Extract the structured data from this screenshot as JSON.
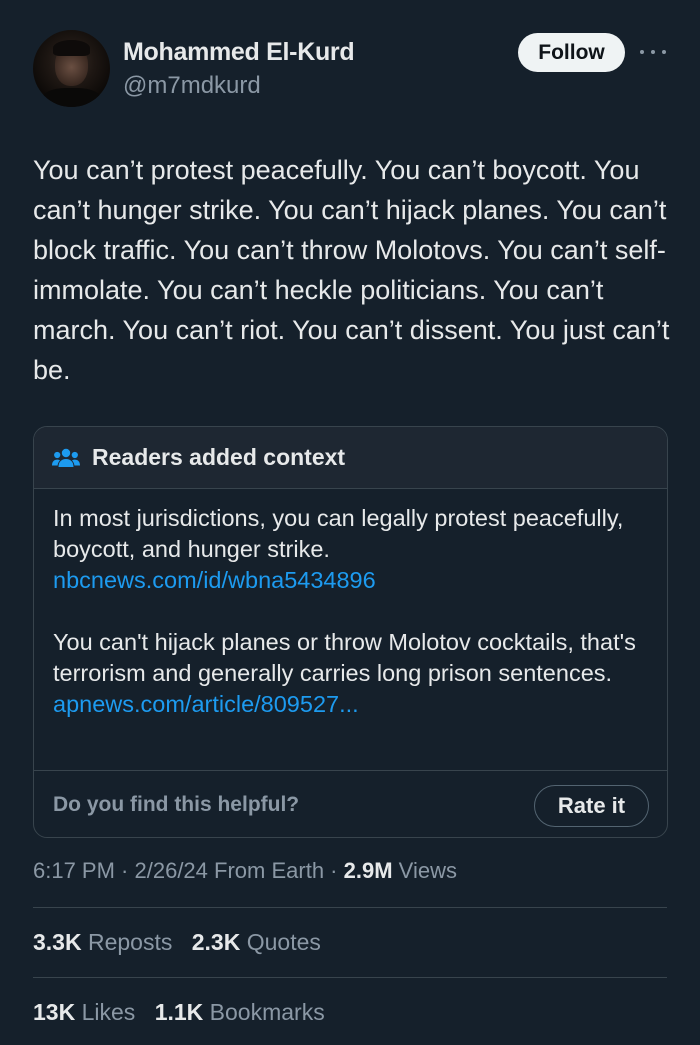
{
  "author": {
    "name": "Mohammed El-Kurd",
    "handle": "@m7mdkurd",
    "follow_label": "Follow"
  },
  "tweet": {
    "text": "You can’t protest peacefully. You can’t boycott. You can’t hunger strike. You can’t hijack planes. You can’t block traffic. You can’t throw Molotovs. You can’t self-immolate. You can’t heckle politicians. You can’t march. You can’t riot. You can’t dissent. You just can’t be."
  },
  "community_note": {
    "title": "Readers added context",
    "paragraph_1": "In most jurisdictions, you can legally protest peacefully, boycott, and hunger strike.",
    "link_1": "nbcnews.com/id/wbna5434896",
    "paragraph_2": "You can't hijack planes or throw Molotov cocktails, that's terrorism and generally carries long prison sentences.",
    "link_2": "apnews.com/article/809527...",
    "helpful_question": "Do you find this helpful?",
    "rate_label": "Rate it"
  },
  "meta": {
    "time": "6:17 PM",
    "date": "2/26/24",
    "source": "From Earth",
    "views_count": "2.9M",
    "views_label": "Views"
  },
  "stats": {
    "reposts_count": "3.3K",
    "reposts_label": "Reposts",
    "quotes_count": "2.3K",
    "quotes_label": "Quotes",
    "likes_count": "13K",
    "likes_label": "Likes",
    "bookmarks_count": "1.1K",
    "bookmarks_label": "Bookmarks"
  },
  "colors": {
    "background": "#15202b",
    "link": "#1d9bf0",
    "secondary_text": "#8b98a5",
    "primary_text": "#e7e9ea"
  }
}
